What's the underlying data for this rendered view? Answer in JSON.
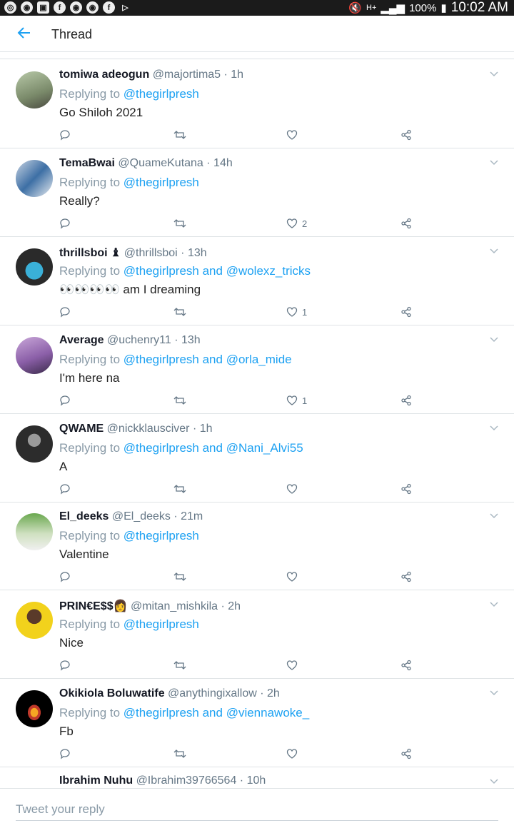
{
  "status_bar": {
    "battery": "100%",
    "time": "10:02 AM",
    "network": "H+",
    "left_icons": [
      "notification-icon",
      "chrome-icon",
      "gallery-icon",
      "facebook-icon",
      "chrome-icon",
      "chrome-icon",
      "facebook-icon",
      "play-icon"
    ]
  },
  "header": {
    "title": "Thread",
    "back_icon": "arrow-left-icon"
  },
  "colors": {
    "link": "#1da1f2",
    "muted": "#657786",
    "divider": "#dfe3e6",
    "status_bar": "#1b1b1b"
  },
  "tweets": [
    {
      "name": "tomiwa adeogun",
      "handle": "@majortima5 · 1h",
      "replying_prefix": "Replying to",
      "mentions": "@thegirlpresh",
      "text": "Go Shiloh 2021",
      "likes": ""
    },
    {
      "name": "TemaBwai",
      "handle": "@QuameKutana · 14h",
      "replying_prefix": "Replying to",
      "mentions": "@thegirlpresh",
      "text": "Really?",
      "likes": "2"
    },
    {
      "name": "thrillsboi ♝",
      "handle": "@thrillsboi · 13h",
      "replying_prefix": "Replying to",
      "mentions": "@thegirlpresh and @wolexz_tricks",
      "text": "👀👀👀👀 am I dreaming",
      "likes": "1"
    },
    {
      "name": "Average",
      "handle": "@uchenry11 · 13h",
      "replying_prefix": "Replying to",
      "mentions": "@thegirlpresh and @orla_mide",
      "text": "I'm here na",
      "likes": "1"
    },
    {
      "name": "QWAME",
      "handle": "@nickklausciver · 1h",
      "replying_prefix": "Replying to",
      "mentions": "@thegirlpresh and @Nani_Alvi55",
      "text": "A",
      "likes": ""
    },
    {
      "name": "El_deeks",
      "handle": "@El_deeks · 21m",
      "replying_prefix": "Replying to",
      "mentions": "@thegirlpresh",
      "text": "Valentine",
      "likes": ""
    },
    {
      "name": "PRIN€E$$👩",
      "handle": "@mitan_mishkila · 2h",
      "replying_prefix": "Replying to",
      "mentions": "@thegirlpresh",
      "text": "Nice",
      "likes": ""
    },
    {
      "name": "Okikiola Boluwatife",
      "handle": "@anythingixallow · 2h",
      "replying_prefix": "Replying to",
      "mentions": "@thegirlpresh and @viennawoke_",
      "text": "Fb",
      "likes": ""
    },
    {
      "name": "Ibrahim Nuhu",
      "handle": "@Ibrahim39766564 · 10h",
      "replying_prefix": "",
      "mentions": "",
      "text": "",
      "likes": ""
    }
  ],
  "compose": {
    "placeholder": "Tweet your reply"
  }
}
